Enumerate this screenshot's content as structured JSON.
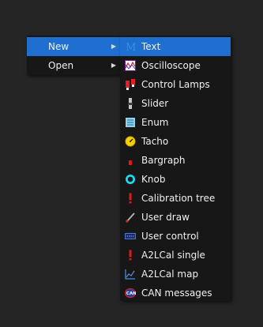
{
  "main_menu": {
    "items": [
      {
        "label": "New",
        "active": true
      },
      {
        "label": "Open",
        "active": false
      }
    ]
  },
  "sub_menu": {
    "items": [
      {
        "label": "Text",
        "icon": "text-icon"
      },
      {
        "label": "Oscilloscope",
        "icon": "oscilloscope-icon"
      },
      {
        "label": "Control Lamps",
        "icon": "control-lamps-icon"
      },
      {
        "label": "Slider",
        "icon": "slider-icon"
      },
      {
        "label": "Enum",
        "icon": "enum-icon"
      },
      {
        "label": "Tacho",
        "icon": "tacho-icon"
      },
      {
        "label": "Bargraph",
        "icon": "bargraph-icon"
      },
      {
        "label": "Knob",
        "icon": "knob-icon"
      },
      {
        "label": "Calibration tree",
        "icon": "calibration-tree-icon"
      },
      {
        "label": "User draw",
        "icon": "user-draw-icon"
      },
      {
        "label": "User control",
        "icon": "user-control-icon"
      },
      {
        "label": "A2LCal single",
        "icon": "a2lcal-single-icon"
      },
      {
        "label": "A2LCal map",
        "icon": "a2lcal-map-icon"
      },
      {
        "label": "CAN messages",
        "icon": "can-messages-icon"
      }
    ]
  },
  "colors": {
    "highlight": "#1e6fd0",
    "menu_bg": "#171717",
    "page_bg": "#252526"
  }
}
